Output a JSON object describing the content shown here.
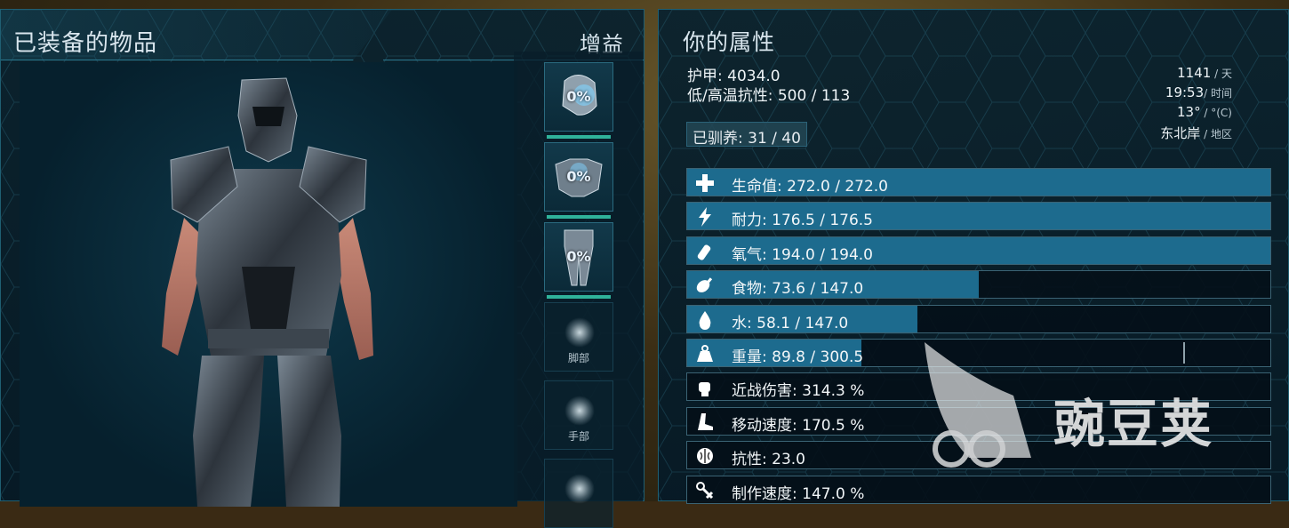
{
  "left_panel": {
    "title": "已装备的物品",
    "buff_label": "增益",
    "slots": [
      {
        "icon": "helmet-icon",
        "percent": "0%",
        "label": ""
      },
      {
        "icon": "chest-armor-icon",
        "percent": "0%",
        "label": ""
      },
      {
        "icon": "leg-armor-icon",
        "percent": "0%",
        "label": ""
      },
      {
        "icon": "empty-slot-icon",
        "percent": "",
        "label": "脚部"
      },
      {
        "icon": "empty-slot-icon",
        "percent": "",
        "label": "手部"
      }
    ]
  },
  "right_panel": {
    "title": "你的属性",
    "armor": "护甲: 4034.0",
    "resistance": "低/高温抗性: 500 / 113",
    "tamed": "已驯养: 31 / 40",
    "info": {
      "day_value": "1141",
      "day_unit": " / 天",
      "time_value": "19:53",
      "time_unit": "/ 时间",
      "temp_value": "13°",
      "temp_unit": " / °(C)",
      "region_value": "东北岸",
      "region_unit": " / 地区"
    },
    "stats": [
      {
        "icon": "health-plus-icon",
        "text": "生命值: 272.0 / 272.0",
        "fill": 1.0
      },
      {
        "icon": "stamina-lightning-icon",
        "text": "耐力: 176.5 / 176.5",
        "fill": 1.0
      },
      {
        "icon": "oxygen-tank-icon",
        "text": "氧气: 194.0 / 194.0",
        "fill": 1.0
      },
      {
        "icon": "food-drumstick-icon",
        "text": "食物: 73.6 / 147.0",
        "fill": 0.5
      },
      {
        "icon": "water-drop-icon",
        "text": "水: 58.1 / 147.0",
        "fill": 0.395
      },
      {
        "icon": "weight-icon",
        "text": "重量: 89.8 / 300.5",
        "fill": 0.299,
        "marker": 0.85
      },
      {
        "icon": "melee-fist-icon",
        "text": "近战伤害: 314.3 %",
        "fill": 0
      },
      {
        "icon": "movement-boot-icon",
        "text": "移动速度: 170.5 %",
        "fill": 0
      },
      {
        "icon": "fortitude-brain-icon",
        "text": "抗性: 23.0",
        "fill": 0
      },
      {
        "icon": "crafting-tools-icon",
        "text": "制作速度: 147.0 %",
        "fill": 0
      }
    ]
  },
  "watermark": {
    "text": "豌豆荚"
  },
  "colors": {
    "bar_fill": "#1d6b8e",
    "slot_bar": "#2fb39a",
    "panel_border": "#1f5f73"
  }
}
